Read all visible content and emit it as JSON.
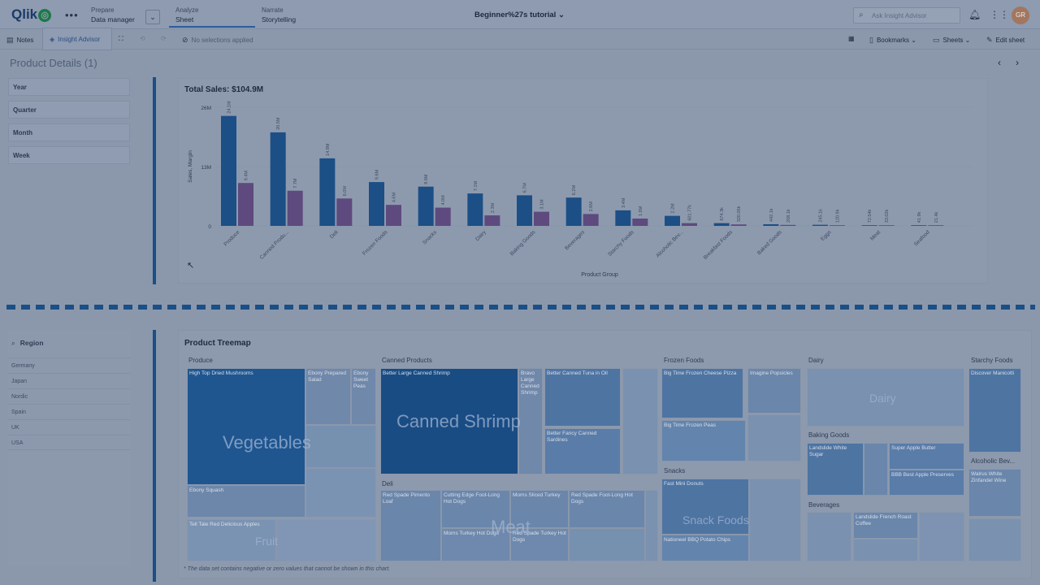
{
  "app": {
    "logo": "Qlik",
    "title": "Beginner%27s tutorial",
    "search_placeholder": "Ask Insight Advisor",
    "avatar_initials": "GR"
  },
  "nav_tabs": [
    {
      "top": "Prepare",
      "sub": "Data manager"
    },
    {
      "top": "Analyze",
      "sub": "Sheet"
    },
    {
      "top": "Narrate",
      "sub": "Storytelling"
    }
  ],
  "toolbar": {
    "notes": "Notes",
    "insight_advisor": "Insight Advisor",
    "selections": "No selections applied",
    "bookmarks": "Bookmarks",
    "sheets": "Sheets",
    "edit_sheet": "Edit sheet"
  },
  "sheet_title": "Product Details (1)",
  "filters": [
    "Year",
    "Quarter",
    "Month",
    "Week"
  ],
  "region_filter": {
    "title": "Region",
    "items": [
      "Germany",
      "Japan",
      "Nordic",
      "Spain",
      "UK",
      "USA"
    ]
  },
  "chart_data": {
    "type": "bar",
    "title": "Total Sales: $104.9M",
    "xlabel": "Product Group",
    "ylabel": "Sales, Margin",
    "yticks": [
      "0",
      "13M",
      "26M"
    ],
    "ylim": [
      0,
      26
    ],
    "categories": [
      "Produce",
      "Canned Produ...",
      "Deli",
      "Frozen Foods",
      "Snacks",
      "Dairy",
      "Baking Goods",
      "Beverages",
      "Starchy Foods",
      "Alcoholic Bev...",
      "Breakfast Foods",
      "Baked Goods",
      "Eggs",
      "Meat",
      "Seafood"
    ],
    "series": [
      {
        "name": "Sales",
        "color": "#1b4f86",
        "values": [
          24.1,
          20.5,
          14.8,
          9.6,
          8.6,
          7.1,
          6.7,
          6.2,
          3.4,
          2.2,
          0.6,
          0.36,
          0.24,
          0.07,
          0.04
        ],
        "labels": [
          "24.1M",
          "20.5M",
          "14.8M",
          "9.6M",
          "8.6M",
          "7.1M",
          "6.7M",
          "6.2M",
          "3.4M",
          "2.2M",
          "674.3k",
          "442.1k",
          "245.1k",
          "72.54k",
          "41.9k"
        ]
      },
      {
        "name": "Margin",
        "color": "#5e4a7e",
        "values": [
          9.4,
          7.7,
          6.0,
          4.6,
          4.0,
          2.3,
          3.1,
          2.6,
          1.6,
          0.6,
          0.32,
          0.21,
          0.12,
          0.03,
          0.02
        ],
        "labels": [
          "9.4M",
          "7.7M",
          "6.0M",
          "4.6M",
          "4.0M",
          "2.3M",
          "3.1M",
          "2.6M",
          "1.6M",
          "601.77k",
          "320.05k",
          "208.1k",
          "120.9k",
          "33.02k",
          "21.4k"
        ]
      }
    ]
  },
  "treemap": {
    "title": "Product Treemap",
    "sections": [
      "Produce",
      "Canned Products",
      "Frozen Foods",
      "Dairy",
      "Starchy Foods",
      "Baking Goods",
      "Alcoholic Bev...",
      "Deli",
      "Snacks",
      "Beverages"
    ],
    "big_labels": [
      "Vegetables",
      "Canned Shrimp",
      "Meat",
      "Dairy",
      "Snack Foods",
      "Fruit"
    ],
    "tiles": {
      "t1": "High Top Dried Mushrooms",
      "t2": "Ebony Prepared Salad",
      "t3": "Ebony Sweet Peas",
      "t4": "Ebony Squash",
      "t5": "Tell Tale Red Delicious Apples",
      "t6": "Better Large Canned Shrimp",
      "t7": "Bravo Large Canned Shrimp",
      "t8": "Better Canned Tuna in Oil",
      "t9": "Better Fancy Canned Sardines",
      "t10": "Red Spade Pimento Loaf",
      "t11": "Cutting Edge Foot-Long Hot Dogs",
      "t12": "Moms Sliced Turkey",
      "t13": "Red Spade Foot-Long Hot Dogs",
      "t14": "Moms Turkey Hot Dogs",
      "t15": "Red Spade Turkey Hot Dogs",
      "t16": "Big Time Frozen Cheese Pizza",
      "t17": "Imagine Popsicles",
      "t18": "Big Time Frozen Peas",
      "t19": "Fast Mini Donuts",
      "t20": "Nationeel BBQ Potato Chips",
      "t21": "Landslide White Sugar",
      "t22": "Super Apple Butter",
      "t23": "BBB Best Apple Preserves",
      "t24": "Landslide French Roast Coffee",
      "t25": "Discover Manicotti",
      "t26": "Walrus White Zinfandel Wine"
    },
    "footnote": "* The data set contains negative or zero values that cannot be shown in this chart."
  }
}
